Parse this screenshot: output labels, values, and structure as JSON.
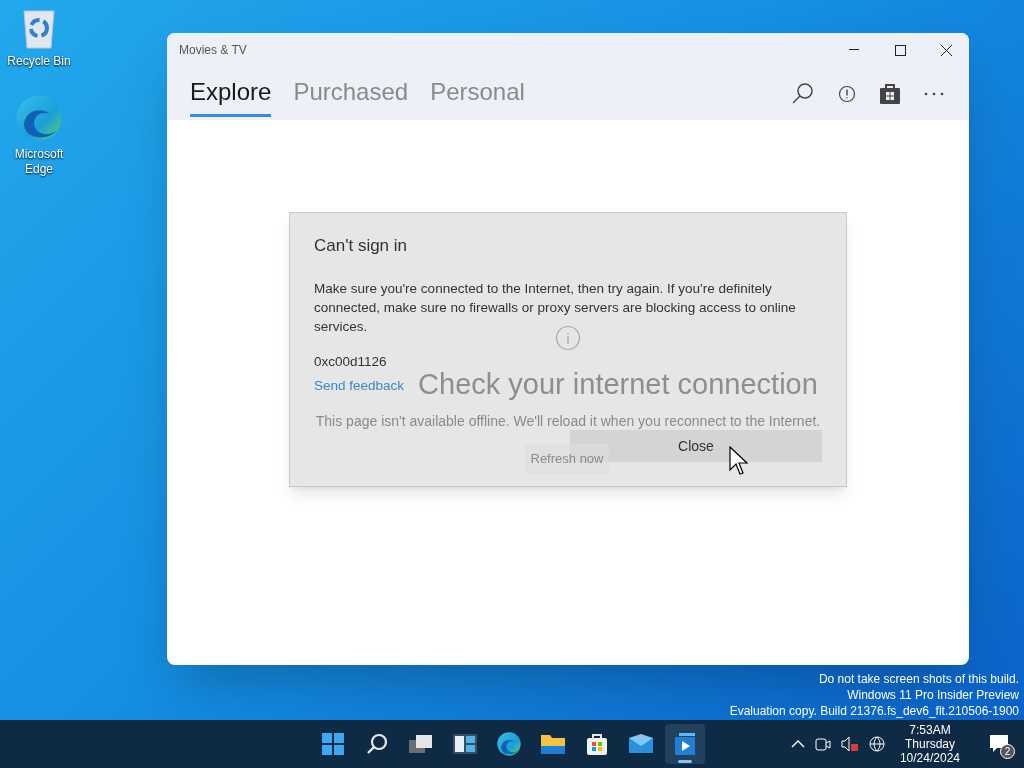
{
  "desktop_icons": [
    {
      "kind": "recycle",
      "label": "Recycle Bin"
    },
    {
      "kind": "edge",
      "label": "Microsoft Edge"
    }
  ],
  "window": {
    "title": "Movies & TV",
    "tabs": [
      {
        "label": "Explore",
        "selected": true
      },
      {
        "label": "Purchased",
        "selected": false
      },
      {
        "label": "Personal",
        "selected": false
      }
    ],
    "page": {
      "heading": "Check your internet connection",
      "message": "This page isn't available offline. We'll reload it when you reconnect to the Internet.",
      "refresh_button": "Refresh now"
    },
    "dialog": {
      "title": "Can't sign in",
      "message": "Make sure you're connected to the Internet, then try again. If you're definitely connected, make sure no firewalls or proxy servers are blocking access to online services.",
      "code": "0xc00d1126",
      "link": "Send feedback",
      "close_button": "Close"
    }
  },
  "build_notice": [
    "Do not take screen shots of this build.",
    "Windows 11 Pro Insider Preview",
    "Evaluation copy. Build 21376.fs_dev6_flt.210506-1900"
  ],
  "taskbar": {
    "apps": [
      {
        "kind": "start",
        "selected": false
      },
      {
        "kind": "search",
        "selected": false
      },
      {
        "kind": "taskview",
        "selected": false
      },
      {
        "kind": "widgets",
        "selected": false
      },
      {
        "kind": "edge",
        "selected": false
      },
      {
        "kind": "explorer",
        "selected": false
      },
      {
        "kind": "store",
        "selected": false
      },
      {
        "kind": "mail",
        "selected": false
      },
      {
        "kind": "movies",
        "selected": true
      }
    ],
    "time": "7:53AM",
    "day": "Thursday",
    "date": "10/24/2024",
    "notifications": "2"
  }
}
